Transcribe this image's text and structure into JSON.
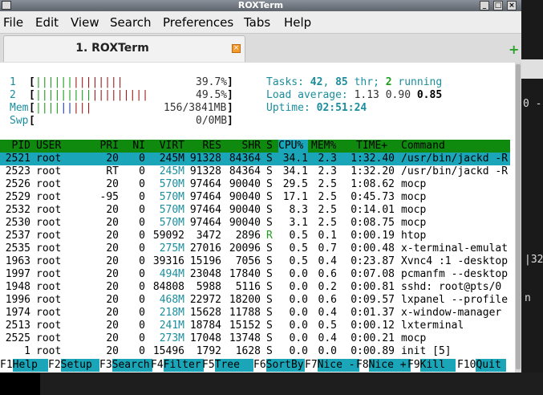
{
  "window": {
    "title": "ROXTerm"
  },
  "menu": [
    "File",
    "Edit",
    "View",
    "Search",
    "Preferences",
    "Tabs",
    "Help"
  ],
  "tab": {
    "label": "1. ROXTerm"
  },
  "meters": {
    "cpu1": {
      "label": "1",
      "bar": "||||||||||||||",
      "value": "39.7%"
    },
    "cpu2": {
      "label": "2",
      "bar": "||||||||||||||||||",
      "value": "49.5%"
    },
    "mem": {
      "label": "Mem",
      "bar": "|||||||||",
      "value": "156/3841MB"
    },
    "swp": {
      "label": "Swp",
      "bar": "",
      "value": "0/0MB"
    }
  },
  "summary": {
    "tasks_label": "Tasks:",
    "tasks": "42",
    "thr_count": "85",
    "thr_label": "thr;",
    "running": "2",
    "running_label": "running",
    "load_label": "Load average:",
    "load1": "1.13",
    "load5": "0.90",
    "load15": "0.85",
    "uptime_label": "Uptime:",
    "uptime": "02:51:24"
  },
  "columns": [
    "PID",
    "USER",
    "PRI",
    "NI",
    "VIRT",
    "RES",
    "SHR",
    "S",
    "CPU%",
    "MEM%",
    "TIME+",
    "Command"
  ],
  "processes": [
    {
      "pid": "2521",
      "user": "root",
      "pri": "20",
      "ni": "0",
      "virt": "245M",
      "res": "91328",
      "shr": "84364",
      "s": "S",
      "cpu": "34.1",
      "mem": "2.3",
      "time": "1:32.40",
      "cmd": "/usr/bin/jackd -R"
    },
    {
      "pid": "2523",
      "user": "root",
      "pri": "RT",
      "ni": "0",
      "virt": "245M",
      "res": "91328",
      "shr": "84364",
      "s": "S",
      "cpu": "34.1",
      "mem": "2.3",
      "time": "1:32.20",
      "cmd": "/usr/bin/jackd -R"
    },
    {
      "pid": "2526",
      "user": "root",
      "pri": "20",
      "ni": "0",
      "virt": "570M",
      "res": "97464",
      "shr": "90040",
      "s": "S",
      "cpu": "29.5",
      "mem": "2.5",
      "time": "1:08.62",
      "cmd": "mocp"
    },
    {
      "pid": "2529",
      "user": "root",
      "pri": "-95",
      "ni": "0",
      "virt": "570M",
      "res": "97464",
      "shr": "90040",
      "s": "S",
      "cpu": "17.1",
      "mem": "2.5",
      "time": "0:45.73",
      "cmd": "mocp"
    },
    {
      "pid": "2532",
      "user": "root",
      "pri": "20",
      "ni": "0",
      "virt": "570M",
      "res": "97464",
      "shr": "90040",
      "s": "S",
      "cpu": "8.3",
      "mem": "2.5",
      "time": "0:14.01",
      "cmd": "mocp"
    },
    {
      "pid": "2530",
      "user": "root",
      "pri": "20",
      "ni": "0",
      "virt": "570M",
      "res": "97464",
      "shr": "90040",
      "s": "S",
      "cpu": "3.1",
      "mem": "2.5",
      "time": "0:08.75",
      "cmd": "mocp"
    },
    {
      "pid": "2537",
      "user": "root",
      "pri": "20",
      "ni": "0",
      "virt": "59092",
      "res": "3472",
      "shr": "2896",
      "s": "R",
      "cpu": "0.5",
      "mem": "0.1",
      "time": "0:00.19",
      "cmd": "htop"
    },
    {
      "pid": "2535",
      "user": "root",
      "pri": "20",
      "ni": "0",
      "virt": "275M",
      "res": "27016",
      "shr": "20096",
      "s": "S",
      "cpu": "0.5",
      "mem": "0.7",
      "time": "0:00.48",
      "cmd": "x-terminal-emulat"
    },
    {
      "pid": "1963",
      "user": "root",
      "pri": "20",
      "ni": "0",
      "virt": "39316",
      "res": "15196",
      "shr": "7056",
      "s": "S",
      "cpu": "0.5",
      "mem": "0.4",
      "time": "0:23.87",
      "cmd": "Xvnc4 :1 -desktop"
    },
    {
      "pid": "1997",
      "user": "root",
      "pri": "20",
      "ni": "0",
      "virt": "494M",
      "res": "23048",
      "shr": "17840",
      "s": "S",
      "cpu": "0.0",
      "mem": "0.6",
      "time": "0:07.08",
      "cmd": "pcmanfm --desktop"
    },
    {
      "pid": "1948",
      "user": "root",
      "pri": "20",
      "ni": "0",
      "virt": "84808",
      "res": "5988",
      "shr": "5116",
      "s": "S",
      "cpu": "0.0",
      "mem": "0.2",
      "time": "0:00.81",
      "cmd": "sshd: root@pts/0"
    },
    {
      "pid": "1996",
      "user": "root",
      "pri": "20",
      "ni": "0",
      "virt": "468M",
      "res": "22972",
      "shr": "18200",
      "s": "S",
      "cpu": "0.0",
      "mem": "0.6",
      "time": "0:09.57",
      "cmd": "lxpanel --profile"
    },
    {
      "pid": "1974",
      "user": "root",
      "pri": "20",
      "ni": "0",
      "virt": "218M",
      "res": "15628",
      "shr": "11788",
      "s": "S",
      "cpu": "0.0",
      "mem": "0.4",
      "time": "0:01.37",
      "cmd": "x-window-manager"
    },
    {
      "pid": "2513",
      "user": "root",
      "pri": "20",
      "ni": "0",
      "virt": "241M",
      "res": "18784",
      "shr": "15152",
      "s": "S",
      "cpu": "0.0",
      "mem": "0.5",
      "time": "0:00.12",
      "cmd": "lxterminal"
    },
    {
      "pid": "2525",
      "user": "root",
      "pri": "20",
      "ni": "0",
      "virt": "273M",
      "res": "17048",
      "shr": "13748",
      "s": "S",
      "cpu": "0.0",
      "mem": "0.4",
      "time": "0:00.21",
      "cmd": "mocp"
    },
    {
      "pid": "1",
      "user": "root",
      "pri": "20",
      "ni": "0",
      "virt": "15496",
      "res": "1792",
      "shr": "1628",
      "s": "S",
      "cpu": "0.0",
      "mem": "0.0",
      "time": "0:00.89",
      "cmd": "init [5]"
    }
  ],
  "fkeys": [
    {
      "key": "F1",
      "label": "Help"
    },
    {
      "key": "F2",
      "label": "Setup"
    },
    {
      "key": "F3",
      "label": "Search"
    },
    {
      "key": "F4",
      "label": "Filter"
    },
    {
      "key": "F5",
      "label": "Tree"
    },
    {
      "key": "F6",
      "label": "SortBy"
    },
    {
      "key": "F7",
      "label": "Nice -"
    },
    {
      "key": "F8",
      "label": "Nice +"
    },
    {
      "key": "F9",
      "label": "Kill"
    },
    {
      "key": "F10",
      "label": "Quit"
    }
  ],
  "background": {
    "snippet_a": "0 -",
    "snippet_b": "|32",
    "snippet_c": "n"
  }
}
